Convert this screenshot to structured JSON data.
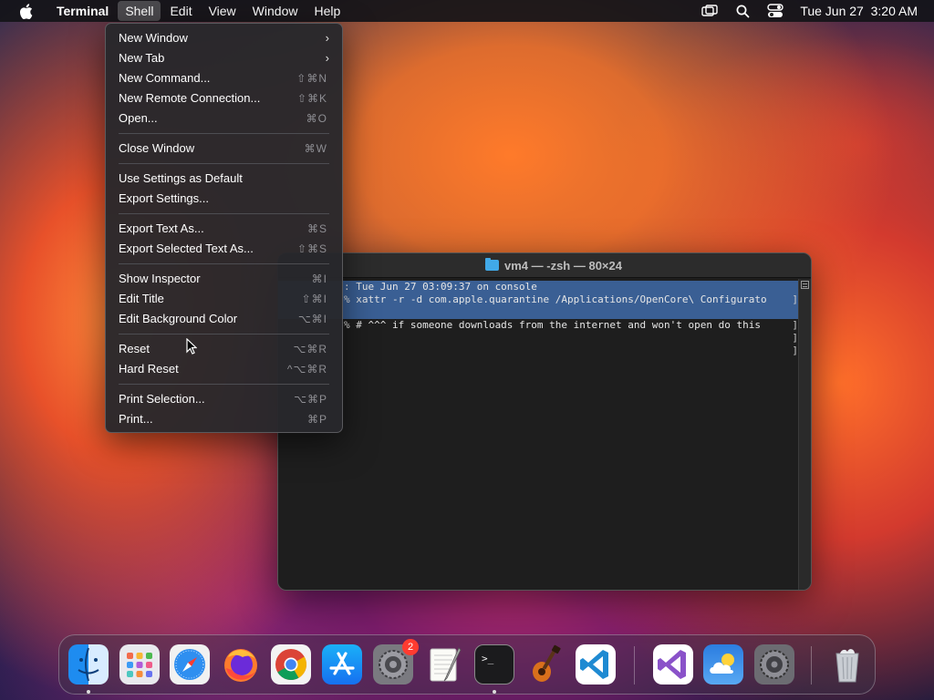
{
  "menubar": {
    "app_name": "Terminal",
    "items": [
      "Shell",
      "Edit",
      "View",
      "Window",
      "Help"
    ],
    "active_item": "Shell",
    "datetime": "Tue Jun 27  3:20 AM"
  },
  "shell_menu": {
    "items": [
      {
        "label": "New Window",
        "shortcut": "",
        "submenu": true
      },
      {
        "label": "New Tab",
        "shortcut": "",
        "submenu": true
      },
      {
        "label": "New Command...",
        "shortcut": "⇧⌘N"
      },
      {
        "label": "New Remote Connection...",
        "shortcut": "⇧⌘K"
      },
      {
        "label": "Open...",
        "shortcut": "⌘O"
      },
      {
        "label": "Close Window",
        "shortcut": "⌘W"
      },
      {
        "label": "Use Settings as Default",
        "shortcut": ""
      },
      {
        "label": "Export Settings...",
        "shortcut": ""
      },
      {
        "label": "Export Text As...",
        "shortcut": "⌘S"
      },
      {
        "label": "Export Selected Text As...",
        "shortcut": "⇧⌘S"
      },
      {
        "label": "Show Inspector",
        "shortcut": "⌘I"
      },
      {
        "label": "Edit Title",
        "shortcut": "⇧⌘I"
      },
      {
        "label": "Edit Background Color",
        "shortcut": "⌥⌘I"
      },
      {
        "label": "Reset",
        "shortcut": "⌥⌘R"
      },
      {
        "label": "Hard Reset",
        "shortcut": "^⌥⌘R"
      },
      {
        "label": "Print Selection...",
        "shortcut": "⌥⌘P"
      },
      {
        "label": "Print...",
        "shortcut": "⌘P"
      }
    ]
  },
  "terminal": {
    "title": "vm4 — -zsh — 80×24",
    "lines": [
      {
        "text": ": Tue Jun 27 03:09:37 on console",
        "selected": true
      },
      {
        "text": "% xattr -r -d com.apple.quarantine /Applications/OpenCore\\ Configurato",
        "selected": true,
        "edge": "]"
      },
      {
        "text": "",
        "selected": true
      },
      {
        "text": "% # ^^^ if someone downloads from the internet and won't open do this ",
        "selected": false,
        "edge": "]"
      },
      {
        "text": "",
        "selected": false,
        "edge": "]"
      },
      {
        "text": "",
        "selected": false,
        "edge": "]"
      }
    ]
  },
  "dock": {
    "apps": [
      {
        "name": "Finder",
        "running": true
      },
      {
        "name": "Launchpad",
        "running": false
      },
      {
        "name": "Safari",
        "running": false
      },
      {
        "name": "Firefox",
        "running": false
      },
      {
        "name": "Chrome",
        "running": false
      },
      {
        "name": "App Store",
        "running": false
      },
      {
        "name": "System Preferences",
        "running": false,
        "badge": "2"
      },
      {
        "name": "TextEdit",
        "running": false
      },
      {
        "name": "Terminal",
        "running": true
      },
      {
        "name": "GarageBand",
        "running": false
      },
      {
        "name": "Visual Studio Code",
        "running": false
      },
      {
        "name": "Visual Studio",
        "running": false
      },
      {
        "name": "Weather",
        "running": false
      },
      {
        "name": "System Settings",
        "running": false
      },
      {
        "name": "Trash",
        "running": false
      }
    ]
  }
}
